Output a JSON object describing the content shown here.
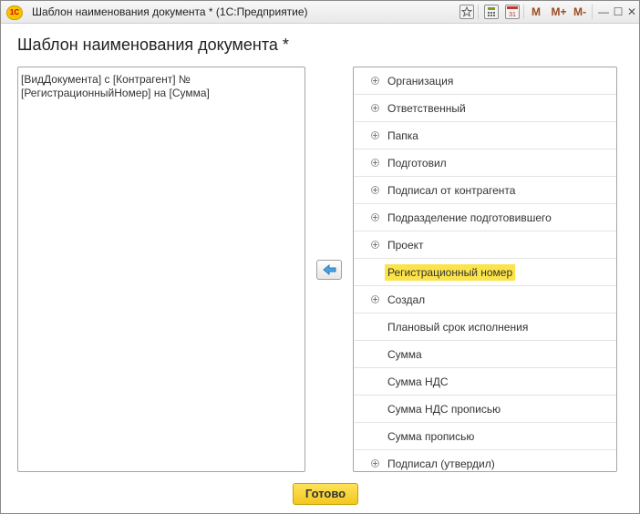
{
  "window": {
    "title": "Шаблон наименования документа * (1С:Предприятие)",
    "app_icon_text": "1С",
    "toolbar": {
      "memory_m": "M",
      "memory_plus": "M+",
      "memory_minus": "M-",
      "minimize": "—",
      "maximize": "☐",
      "close": "✕"
    }
  },
  "page": {
    "title": "Шаблон наименования документа *"
  },
  "template": {
    "value": "[ВидДокумента] с [Контрагент] №\n[РегистрационныйНомер] на [Сумма]"
  },
  "fields": [
    {
      "label": "Организация",
      "expandable": true
    },
    {
      "label": "Ответственный",
      "expandable": true
    },
    {
      "label": "Папка",
      "expandable": true
    },
    {
      "label": "Подготовил",
      "expandable": true
    },
    {
      "label": "Подписал от контрагента",
      "expandable": true
    },
    {
      "label": "Подразделение подготовившего",
      "expandable": true
    },
    {
      "label": "Проект",
      "expandable": true
    },
    {
      "label": "Регистрационный номер",
      "expandable": false,
      "selected": true
    },
    {
      "label": "Создал",
      "expandable": true
    },
    {
      "label": "Плановый срок исполнения",
      "expandable": false
    },
    {
      "label": "Сумма",
      "expandable": false
    },
    {
      "label": "Сумма НДС",
      "expandable": false
    },
    {
      "label": "Сумма НДС прописью",
      "expandable": false
    },
    {
      "label": "Сумма прописью",
      "expandable": false
    },
    {
      "label": "Подписал (утвердил)",
      "expandable": true
    }
  ],
  "buttons": {
    "done_label": "Готово",
    "move_icon": "arrow-left-icon"
  },
  "colors": {
    "selection": "#fbe34a",
    "primary_button": "#f2c81e"
  }
}
